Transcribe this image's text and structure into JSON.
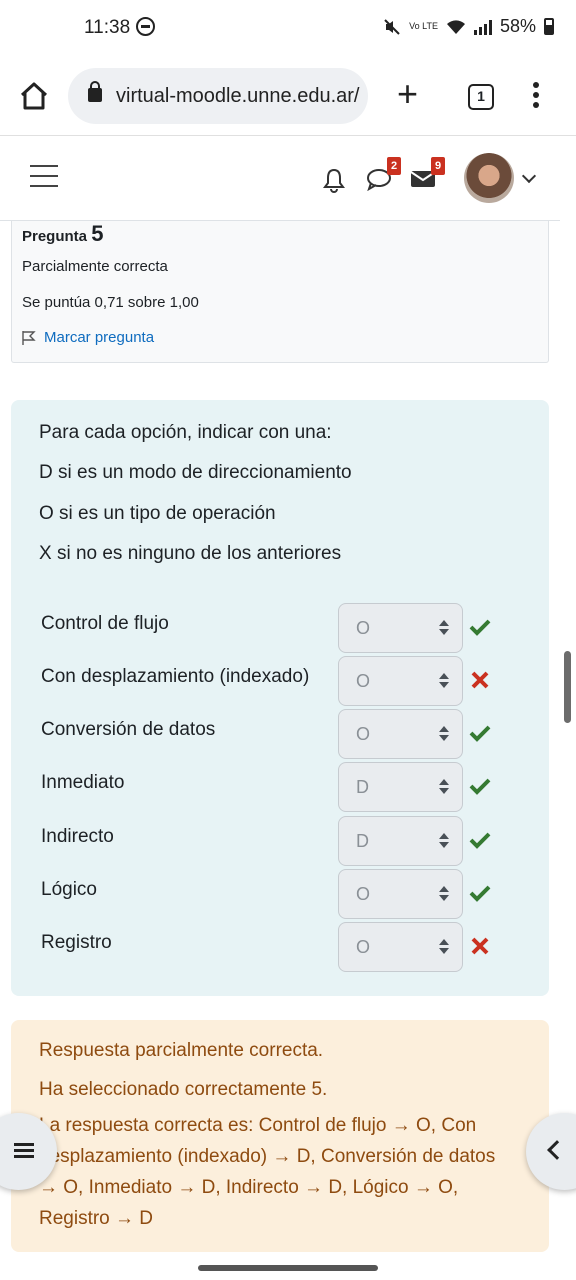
{
  "status": {
    "time": "11:38",
    "battery": "58%",
    "volte": "Vo LTE"
  },
  "browser": {
    "url": "virtual-moodle.unne.edu.ar/",
    "tab_count": "1"
  },
  "nav": {
    "chat_badge": "2",
    "mail_badge": "9"
  },
  "question": {
    "label": "Pregunta",
    "number": "5",
    "state": "Parcialmente correcta",
    "grade": "Se puntúa 0,71 sobre 1,00",
    "flag_label": "Marcar pregunta"
  },
  "qtext": [
    "Para cada opción, indicar con una:",
    "D si es un modo de direccionamiento",
    "O si es un tipo de operación",
    "X si no es ninguno de los anteriores"
  ],
  "rows": [
    {
      "label": "Control de flujo",
      "value": "O",
      "correct": true
    },
    {
      "label": "Con desplazamiento (indexado)",
      "value": "O",
      "correct": false
    },
    {
      "label": "Conversión de datos",
      "value": "O",
      "correct": true
    },
    {
      "label": "Inmediato",
      "value": "D",
      "correct": true
    },
    {
      "label": "Indirecto",
      "value": "D",
      "correct": true
    },
    {
      "label": "Lógico",
      "value": "O",
      "correct": true
    },
    {
      "label": "Registro",
      "value": "O",
      "correct": false
    }
  ],
  "feedback": {
    "line1": "Respuesta parcialmente correcta.",
    "line2": "Ha seleccionado correctamente 5.",
    "line3": "La respuesta correcta es: Control de flujo → O, Con desplazamiento (indexado) → D, Conversión de datos → O, Inmediato → D, Indirecto → D, Lógico → O, Registro → D"
  },
  "colors": {
    "correct": "#357a32",
    "incorrect": "#ca3120",
    "link": "#0f6cbf",
    "formulation_bg": "#e7f3f5",
    "feedback_bg": "#fcefdc",
    "feedback_text": "#8e4b10"
  },
  "icons": [
    "home-icon",
    "lock-icon",
    "plus-icon",
    "tab-switcher-icon",
    "menu-icon",
    "bell-icon",
    "chat-icon",
    "mail-icon",
    "flag-icon",
    "check-icon",
    "cross-icon",
    "index-icon",
    "chevron-left-icon"
  ]
}
